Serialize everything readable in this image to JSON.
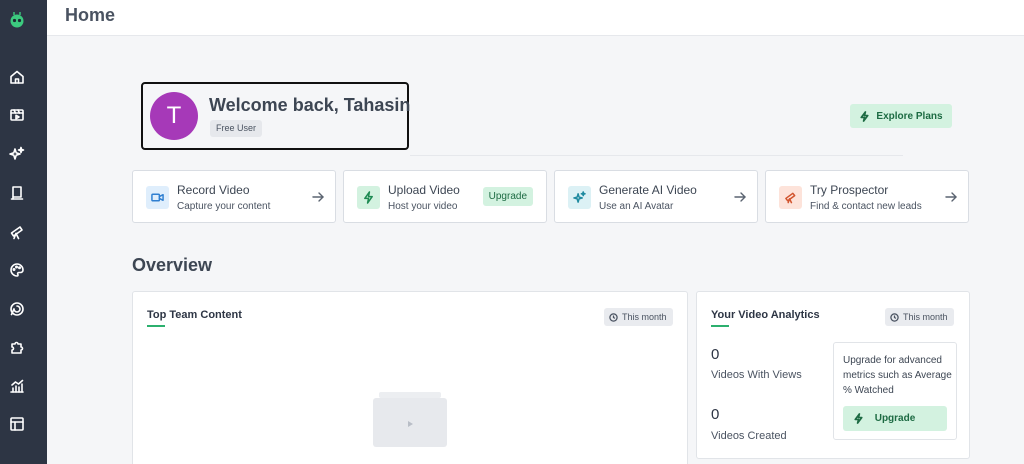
{
  "header": {
    "title": "Home"
  },
  "welcome": {
    "avatar_initial": "T",
    "title": "Welcome back, Tahasin",
    "badge": "Free User"
  },
  "explore_button": {
    "label": "Explore Plans"
  },
  "actions": [
    {
      "title": "Record Video",
      "subtitle": "Capture your content",
      "icon": "video-camera-icon",
      "color": "#dfeefc",
      "stroke": "#2f7fd1"
    },
    {
      "title": "Upload Video",
      "subtitle": "Host your video",
      "icon": "lightning-icon",
      "color": "#d3f2e0",
      "stroke": "#1d8a52",
      "chip": "Upgrade"
    },
    {
      "title": "Generate AI Video",
      "subtitle": "Use an AI Avatar",
      "icon": "sparkles-icon",
      "color": "#dcf1f5",
      "stroke": "#1f8aa0"
    },
    {
      "title": "Try Prospector",
      "subtitle": "Find & contact new leads",
      "icon": "telescope-icon",
      "color": "#fde3da",
      "stroke": "#d2552f"
    }
  ],
  "overview": {
    "title": "Overview",
    "top_team": {
      "title": "Top Team Content",
      "period": "This month"
    },
    "analytics": {
      "title": "Your Video Analytics",
      "period": "This month",
      "stats": [
        {
          "value": "0",
          "label": "Videos With Views"
        },
        {
          "value": "0",
          "label": "Videos Created"
        }
      ],
      "upsell_text": "Upgrade for advanced metrics such as Average % Watched",
      "upsell_button": "Upgrade"
    }
  },
  "sidebar": {
    "items": [
      "home-icon",
      "video-library-icon",
      "sparkles-icon",
      "book-icon",
      "telescope-icon",
      "palette-icon",
      "integrations-icon",
      "puzzle-icon",
      "analytics-icon",
      "templates-icon"
    ]
  },
  "colors": {
    "sidebar": "#2d3544",
    "accent_green": "#d3f2e0",
    "avatar": "#a639b8"
  }
}
